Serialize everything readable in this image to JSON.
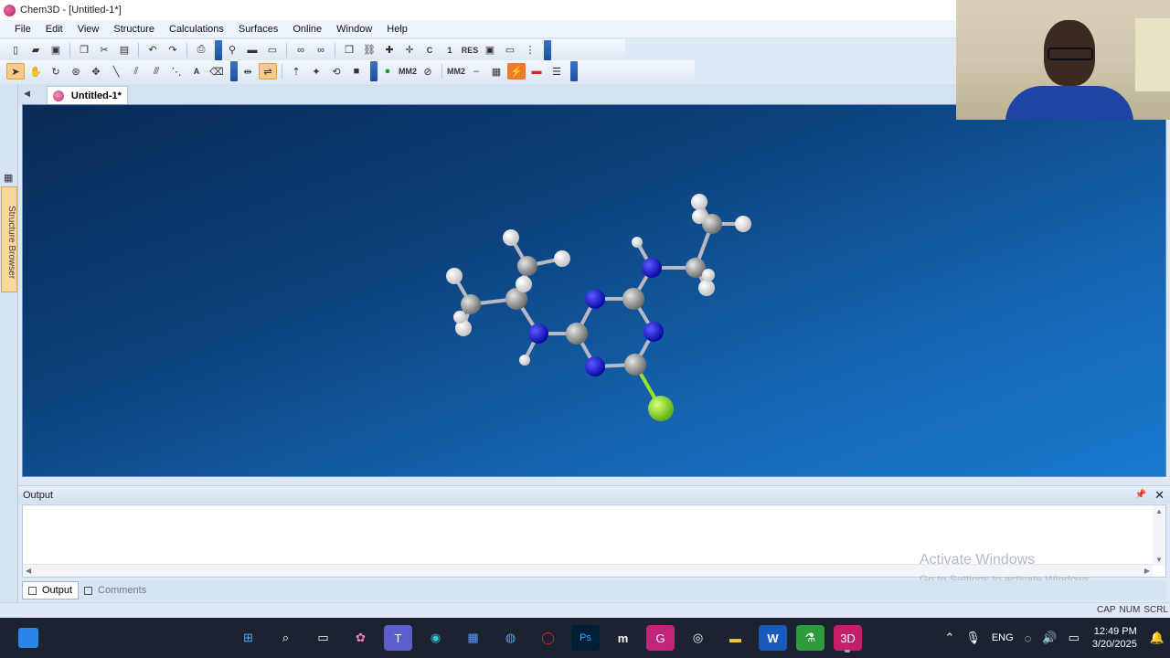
{
  "window": {
    "title": "Chem3D - [Untitled-1*]"
  },
  "menubar": {
    "items": [
      "File",
      "Edit",
      "View",
      "Structure",
      "Calculations",
      "Surfaces",
      "Online",
      "Window",
      "Help"
    ]
  },
  "toolbar1": {
    "text_buttons": {
      "c": "C",
      "i": "1",
      "res": "RES"
    }
  },
  "toolbar2": {
    "text_buttons": {
      "a": "A",
      "mm2a": "MM2",
      "mm2b": "MM2"
    }
  },
  "side_panel": {
    "label": "Structure Browser"
  },
  "document_tabs": [
    {
      "label": "Untitled-1*",
      "active": true
    }
  ],
  "molecule": {
    "description": "ball-and-stick model",
    "atom_colors": {
      "carbon": "#9a9a9a",
      "nitrogen": "#1414d8",
      "hydrogen": "#f4f4f4",
      "chlorine": "#8ee022"
    }
  },
  "output_panel": {
    "title": "Output",
    "content": ""
  },
  "panel_tabs": [
    {
      "label": "Output",
      "active": true
    },
    {
      "label": "Comments",
      "active": false
    }
  ],
  "watermark": {
    "line1": "Activate Windows",
    "line2": "Go to Settings to activate Windows."
  },
  "status_keys": [
    "CAP",
    "NUM",
    "SCRL"
  ],
  "taskbar": {
    "apps": [
      "windows-icon",
      "search-icon",
      "taskview-icon",
      "copilot-icon",
      "teams-icon",
      "edge-icon",
      "store-icon",
      "earth-icon",
      "opera-icon",
      "photoshop-icon",
      "m-icon",
      "app-g-icon",
      "chrome-icon",
      "folder-icon",
      "word-icon",
      "chemdraw-icon",
      "chem3d-icon"
    ],
    "ps_label": "Ps",
    "m_label": "m",
    "word_label": "W",
    "language": "ENG",
    "time": "12:49 PM",
    "date": "3/20/2025"
  }
}
